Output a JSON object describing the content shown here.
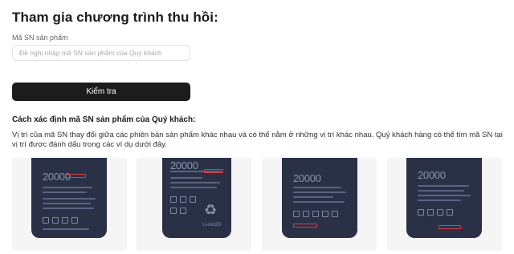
{
  "page": {
    "title": "Tham gia chương trình thu hồi:",
    "sn_field": {
      "label": "Mã SN sản phẩm",
      "value": "",
      "placeholder": "Đề nghị nhập mã SN sản phẩm của Quý khách"
    },
    "check_button": "Kiểm tra",
    "section_heading": "Cách xác định mã SN sản phẩm của Quý khách:",
    "section_desc": "Vị trí của mã SN thay đổi giữa các phiên bản sản phẩm khác nhau và có thể nằm ở những vị trí khác nhau. Quý khách hàng có thể tìm mã SN tại vị trí được đánh dấu trong các ví dụ dưới đây.",
    "examples": [
      {
        "capacity": "20000",
        "liion": ""
      },
      {
        "capacity": "20000",
        "liion": "Li-ion20"
      },
      {
        "capacity": "20000",
        "liion": ""
      },
      {
        "capacity": "20000",
        "liion": ""
      }
    ]
  },
  "colors": {
    "button_bg": "#1c1c1c",
    "device_body": "#2a3147",
    "sn_highlight": "#e23b3b",
    "card_bg": "#f5f5f5"
  }
}
